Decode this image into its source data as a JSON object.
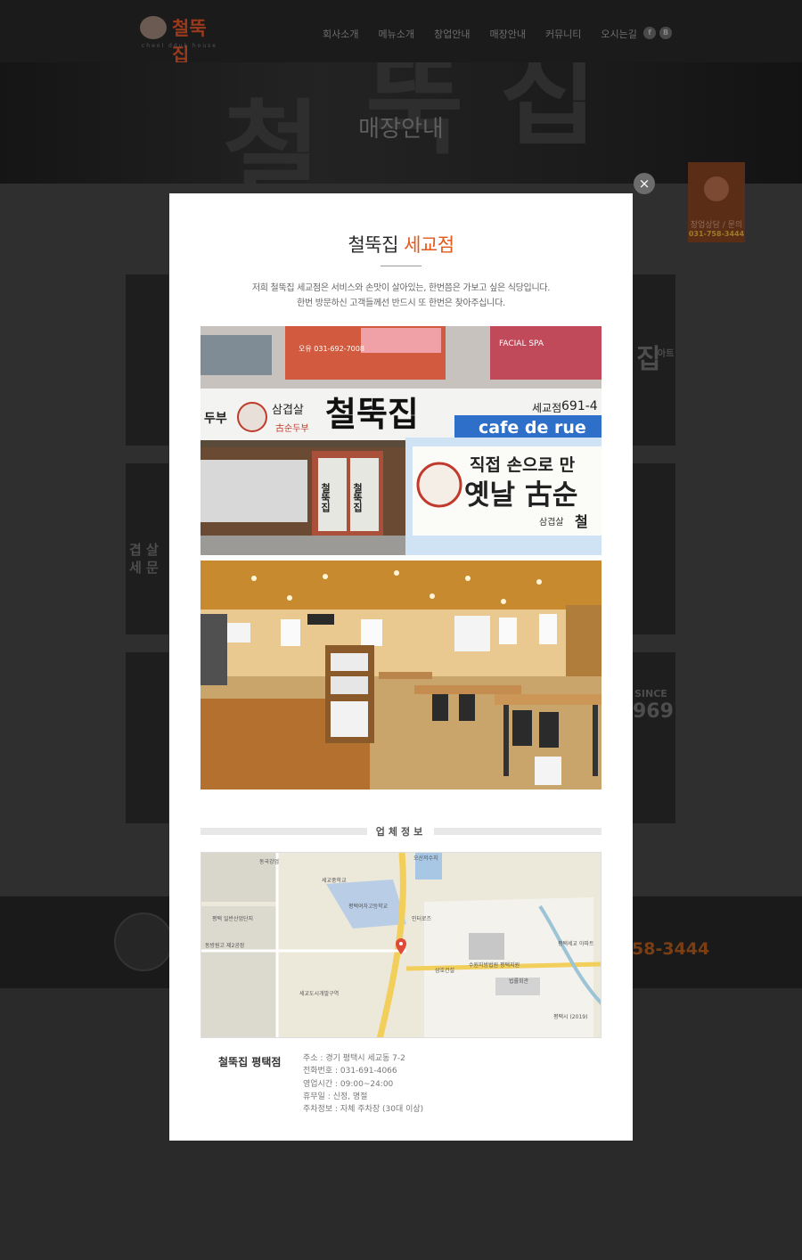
{
  "header": {
    "logo_text": "철뚝집",
    "logo_sub": "cheol dduk house",
    "nav": [
      "회사소개",
      "메뉴소개",
      "창업안내",
      "매장안내",
      "커뮤니티",
      "오시는길"
    ],
    "sns": [
      "f",
      "B"
    ]
  },
  "visual": {
    "title": "매장안내",
    "deco_chars": [
      "철",
      "뚝",
      "집"
    ]
  },
  "background_cards": {
    "left_texts": [
      "겹 살",
      "세 문"
    ],
    "right_texts": [
      "집",
      "아트",
      "SINCE",
      "969"
    ]
  },
  "quick_menu": {
    "label": "창업상담 / 문의",
    "phone": "031-758-3444"
  },
  "footer": {
    "phone_fragment": "58-3444"
  },
  "modal": {
    "close_symbol": "×",
    "title": "철뚝집",
    "title_accent": "세교점",
    "desc_lines": [
      "저희 철뚝집 세교점은 서비스와 손맛이 살아있는, 한번쯤은 가보고 싶은 식당입니다.",
      "한번 방문하신 고객들께선 반드시 또 한번은 찾아주십니다."
    ],
    "exterior_photo": {
      "banner": "오유 031-692-7008",
      "sign_left": "삼겹살",
      "sign_left2": "古순두부",
      "sign_main": "철뚝집",
      "sign_branch": "세교점",
      "sign_phone": "691-4",
      "cafe": "cafe de rue",
      "spa": "FACIAL SPA",
      "left_edge": "두부",
      "door_left": "철뚝집",
      "door_right": "철뚝집",
      "poster_line1": "직접 손으로 만",
      "poster_line2": "옛날 古순",
      "poster_logo": "삼겹살",
      "poster_tail": "철"
    },
    "section_label": "업체정보",
    "map_labels": [
      "동국강업",
      "오산저수지",
      "세교중학교",
      "평택여자고등학교",
      "평택 일반산업단지",
      "동방원고 제2공장",
      "세교도시개발구역",
      "인터로즈",
      "삼호건설",
      "수원지방법원 평택지원",
      "법률회관",
      "평택세교 아파트",
      "평택시 (2019)"
    ],
    "info": {
      "name": "철뚝집 평택점",
      "lines": [
        "주소 : 경기 평택시 세교동 7-2",
        "전화번호 :  031-691-4066",
        "영업시간 : 09:00~24:00",
        "휴무일 : 신정, 명절",
        "주차정보 : 자체 주차장 (30대 이상)"
      ]
    }
  }
}
